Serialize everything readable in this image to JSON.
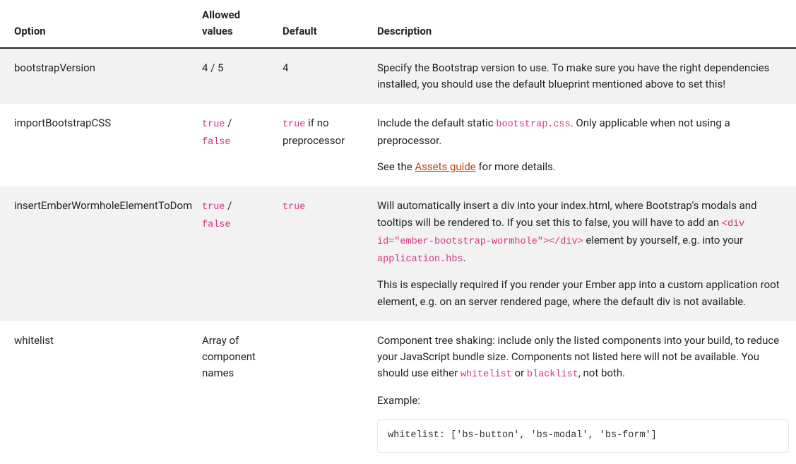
{
  "headers": {
    "option": "Option",
    "allowed": "Allowed values",
    "default": "Default",
    "description": "Description"
  },
  "rows": {
    "bootstrapVersion": {
      "option": "bootstrapVersion",
      "allowed": "4 / 5",
      "default": "4",
      "desc_p1": "Specify the Bootstrap version to use. To make sure you have the right dependencies installed, you should use the default blueprint mentioned above to set this!"
    },
    "importBootstrapCSS": {
      "option": "importBootstrapCSS",
      "allowed_true": "true",
      "allowed_sep": " / ",
      "allowed_false": "false",
      "default_code": "true",
      "default_suffix": " if no preprocessor",
      "desc_p1a": "Include the default static ",
      "desc_p1_code": "bootstrap.css",
      "desc_p1b": ". Only applicable when not using a preprocessor.",
      "desc_p2a": "See the ",
      "desc_p2_link": "Assets guide",
      "desc_p2b": " for more details."
    },
    "insertEmberWormhole": {
      "option": "insertEmberWormholeElementToDom",
      "allowed_true": "true",
      "allowed_sep": " / ",
      "allowed_false": "false",
      "default_code": "true",
      "desc_p1a": "Will automatically insert a div into your index.html, where Bootstrap's modals and tooltips will be rendered to. If you set this to false, you will have to add an ",
      "desc_p1_code1": "<div id=\"ember-bootstrap-wormhole\"></div>",
      "desc_p1b": " element by yourself, e.g. into your ",
      "desc_p1_code2": "application.hbs",
      "desc_p1c": ".",
      "desc_p2": "This is especially required if you render your Ember app into a custom application root element, e.g. on an server rendered page, where the default div is not available."
    },
    "whitelist": {
      "option": "whitelist",
      "allowed": "Array of component names",
      "desc_p1a": "Component tree shaking: include only the listed components into your build, to reduce your JavaScript bundle size. Components not listed here will not be available. You should use either ",
      "desc_p1_code1": "whitelist",
      "desc_p1b": " or ",
      "desc_p1_code2": "blacklist",
      "desc_p1c": ", not both.",
      "desc_p2": "Example:",
      "example": "whitelist: ['bs-button', 'bs-modal', 'bs-form']"
    }
  }
}
